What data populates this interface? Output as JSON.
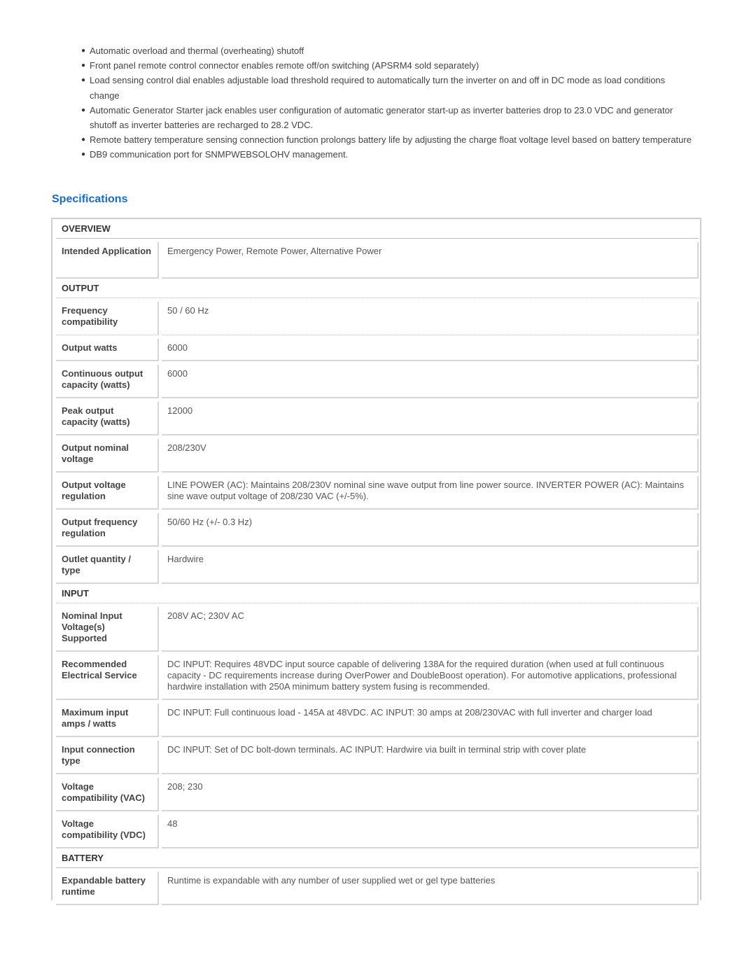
{
  "features": [
    "Automatic overload and thermal (overheating) shutoff",
    "Front panel remote control connector enables remote off/on switching (APSRM4 sold separately)",
    "Load sensing control dial enables adjustable load threshold required to automatically turn the inverter on and off in DC mode as load conditions change",
    "Automatic Generator Starter jack enables user configuration of automatic generator start-up as inverter batteries drop to 23.0 VDC and generator shutoff as inverter batteries are recharged to 28.2 VDC.",
    "Remote battery temperature sensing connection function prolongs battery life by adjusting the charge float voltage level based on battery temperature",
    "DB9 communication port for SNMPWEBSOLOHV management."
  ],
  "bullet_glyph": "●",
  "specifications": {
    "title": "Specifications",
    "sections": [
      {
        "name": "OVERVIEW",
        "rows": [
          {
            "label": "Intended Application",
            "value": "Emergency Power, Remote Power, Alternative Power"
          }
        ]
      },
      {
        "name": "OUTPUT",
        "rows": [
          {
            "label": "Frequency compatibility",
            "value": "50 / 60 Hz"
          },
          {
            "label": "Output watts",
            "value": "6000"
          },
          {
            "label": "Continuous output capacity (watts)",
            "value": "6000"
          },
          {
            "label": "Peak output capacity (watts)",
            "value": "12000"
          },
          {
            "label": "Output nominal voltage",
            "value": "208/230V"
          },
          {
            "label": "Output voltage regulation",
            "value": "LINE POWER (AC): Maintains 208/230V nominal sine wave output from line power source. INVERTER POWER (AC): Maintains sine wave output voltage of 208/230 VAC (+/-5%)."
          },
          {
            "label": "Output frequency regulation",
            "value": "50/60 Hz (+/- 0.3 Hz)"
          },
          {
            "label": "Outlet quantity / type",
            "value": "Hardwire"
          }
        ]
      },
      {
        "name": "INPUT",
        "rows": [
          {
            "label": "Nominal Input Voltage(s) Supported",
            "value": "208V AC; 230V AC"
          },
          {
            "label": "Recommended Electrical Service",
            "value": "DC INPUT: Requires 48VDC input source capable of delivering 138A for the required duration (when used at full continuous capacity - DC requirements increase during OverPower and DoubleBoost operation). For automotive applications, professional hardwire installation with 250A minimum battery system fusing is recommended."
          },
          {
            "label": "Maximum input amps / watts",
            "value": "DC INPUT: Full continuous load - 145A at 48VDC. AC INPUT: 30 amps at 208/230VAC with full inverter and charger load"
          },
          {
            "label": "Input connection type",
            "value": "DC INPUT: Set of DC bolt-down terminals. AC INPUT: Hardwire via built in terminal strip with cover plate"
          },
          {
            "label": "Voltage compatibility (VAC)",
            "value": "208; 230"
          },
          {
            "label": "Voltage compatibility (VDC)",
            "value": "48"
          }
        ]
      },
      {
        "name": "BATTERY",
        "rows": [
          {
            "label": "Expandable battery runtime",
            "value": "Runtime is expandable with any number of user supplied wet or gel type batteries"
          }
        ]
      }
    ]
  }
}
